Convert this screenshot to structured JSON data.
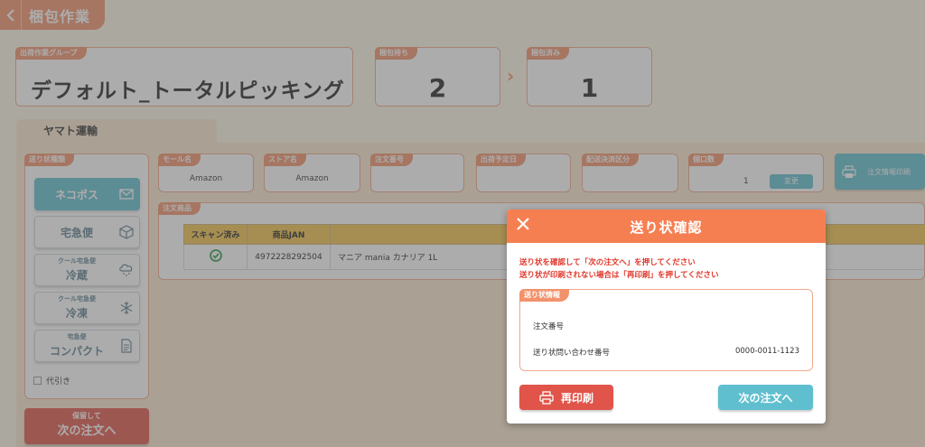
{
  "header": {
    "back_icon": "chevron-left-icon",
    "title": "梱包作業"
  },
  "group": {
    "label": "出荷作業グループ",
    "name": "デフォルト_トータルピッキング"
  },
  "waiting": {
    "label": "梱包待ち",
    "count": "2"
  },
  "done": {
    "label": "梱包済み",
    "count": "1"
  },
  "carrier": {
    "name": "ヤマト運輸"
  },
  "label_types": {
    "label": "送り状種類",
    "items": [
      {
        "sub": "",
        "main": "ネコポス",
        "icon": "mail-icon"
      },
      {
        "sub": "",
        "main": "宅急便",
        "icon": "box-icon"
      },
      {
        "sub": "クール宅急便",
        "main": "冷蔵",
        "icon": "cloud-snow-icon"
      },
      {
        "sub": "クール宅急便",
        "main": "冷凍",
        "icon": "snowflake-icon"
      },
      {
        "sub": "宅急便",
        "main": "コンパクト",
        "icon": "document-icon"
      }
    ],
    "cod_label": "代引き"
  },
  "hold_button": {
    "sub": "保留して",
    "main": "次の注文へ"
  },
  "fields": {
    "mall": {
      "label": "モール名",
      "value": "Amazon"
    },
    "store": {
      "label": "ストア名",
      "value": "Amazon"
    },
    "order_no": {
      "label": "注文番号",
      "value": ""
    },
    "ship_date": {
      "label": "出荷予定日",
      "value": ""
    },
    "payment": {
      "label": "配送決済区分",
      "value": ""
    },
    "pieces": {
      "label": "個口数",
      "value": "1",
      "change": "変更"
    }
  },
  "print_order": {
    "label": "注文情報印刷"
  },
  "items": {
    "label": "注文商品",
    "headers": [
      "スキャン済み",
      "商品JAN",
      ""
    ],
    "rows": [
      {
        "jan": "4972228292504",
        "name": "マニア mania カナリア 1L"
      }
    ]
  },
  "modal": {
    "title": "送り状確認",
    "msg1": "送り状を確認して「次の注文へ」を押してください",
    "msg2": "送り状が印刷されない場合は「再印刷」を押してください",
    "info_label": "送り状情報",
    "order_no_label": "注文番号",
    "order_no_value": "",
    "tracking_label": "送り状問い合わせ番号",
    "tracking_value": "0000-0011-1123",
    "reprint": "再印刷",
    "next": "次の注文へ"
  },
  "colors": {
    "accent": "#f67f52",
    "teal": "#5fbfcf",
    "red": "#e05449",
    "yellow": "#f3c24a"
  }
}
